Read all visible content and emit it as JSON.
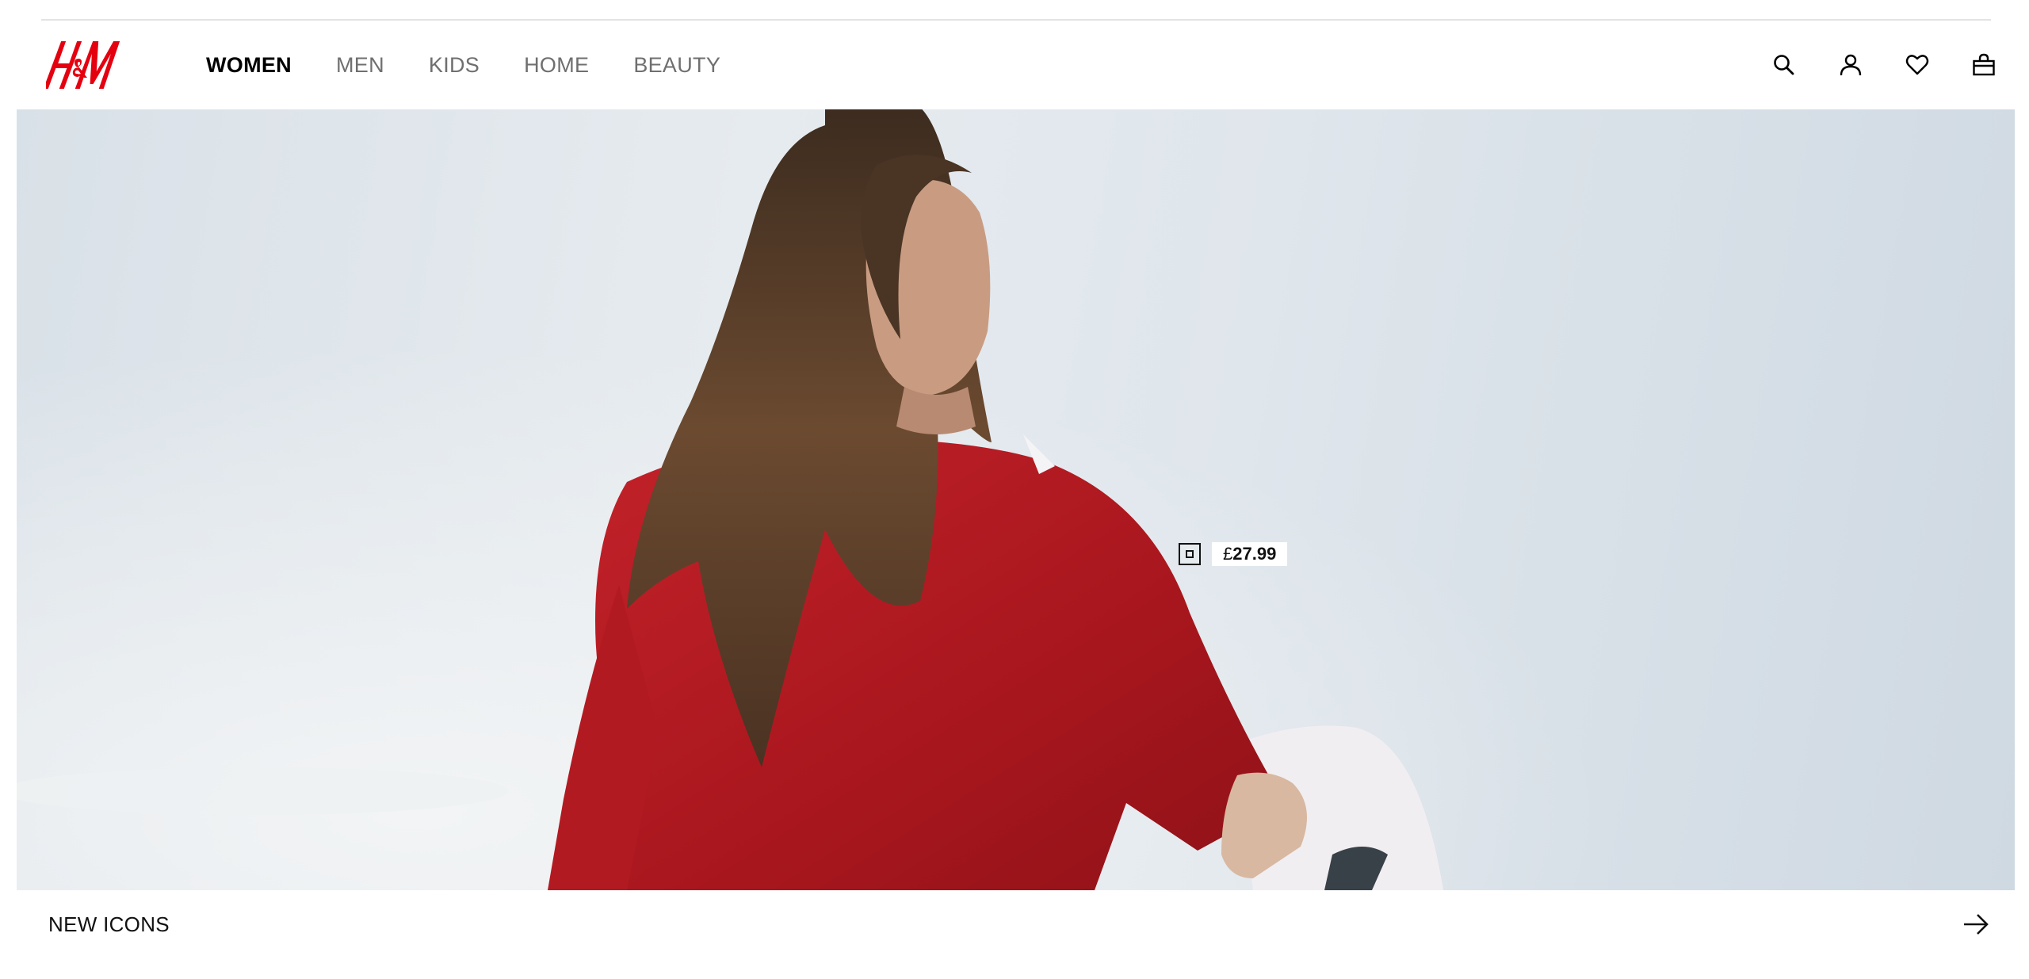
{
  "brand": {
    "logo_text": "H&M",
    "logo_color": "#e50010"
  },
  "nav": {
    "items": [
      {
        "label": "WOMEN",
        "active": true
      },
      {
        "label": "MEN",
        "active": false
      },
      {
        "label": "KIDS",
        "active": false
      },
      {
        "label": "HOME",
        "active": false
      },
      {
        "label": "BEAUTY",
        "active": false
      }
    ]
  },
  "utility": {
    "icons": [
      "search-icon",
      "account-icon",
      "favorites-icon",
      "shopping-bag-icon"
    ]
  },
  "hero": {
    "product_tag": {
      "currency": "£",
      "amount": "27.99"
    }
  },
  "footer": {
    "section_label": "NEW ICONS",
    "arrow_icon": "arrow-right-icon"
  },
  "colors": {
    "accent": "#e50010",
    "sweater_red": "#b3191f",
    "sky": "#dde4ea"
  }
}
